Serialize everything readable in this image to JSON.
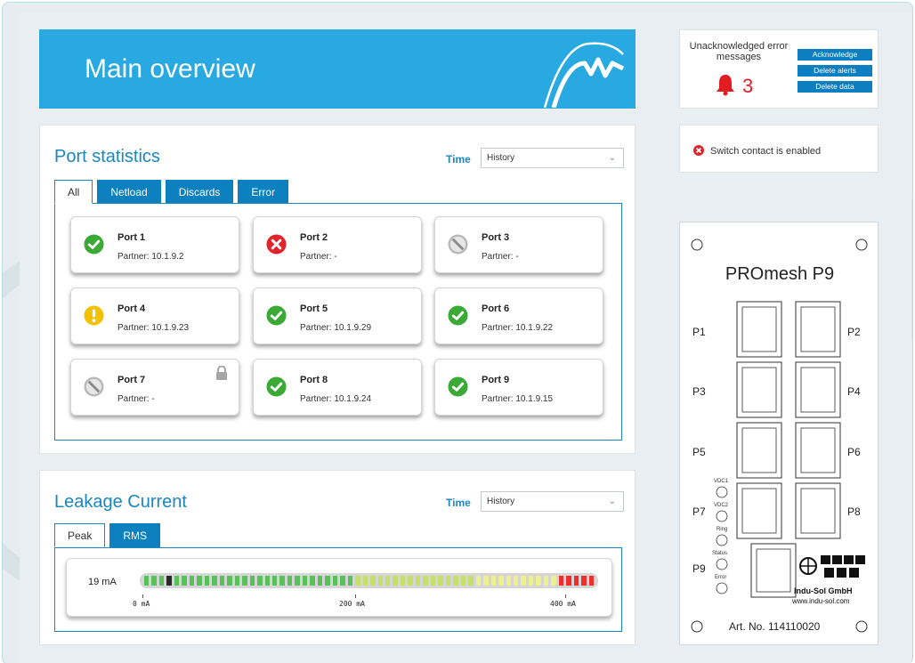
{
  "header": {
    "title": "Main overview"
  },
  "port_statistics": {
    "title": "Port statistics",
    "time_label": "Time",
    "time_value": "History",
    "tabs": [
      "All",
      "Netload",
      "Discards",
      "Error"
    ],
    "ports": [
      {
        "name": "Port 1",
        "partner": "Partner: 10.1.9.2",
        "status": "ok",
        "locked": false
      },
      {
        "name": "Port 2",
        "partner": "Partner: -",
        "status": "error",
        "locked": false
      },
      {
        "name": "Port 3",
        "partner": "Partner: -",
        "status": "disabled",
        "locked": false
      },
      {
        "name": "Port 4",
        "partner": "Partner: 10.1.9.23",
        "status": "warning",
        "locked": false
      },
      {
        "name": "Port 5",
        "partner": "Partner: 10.1.9.29",
        "status": "ok",
        "locked": false
      },
      {
        "name": "Port 6",
        "partner": "Partner: 10.1.9.22",
        "status": "ok",
        "locked": false
      },
      {
        "name": "Port 7",
        "partner": "Partner: -",
        "status": "disabled",
        "locked": true
      },
      {
        "name": "Port 8",
        "partner": "Partner: 10.1.9.24",
        "status": "ok",
        "locked": false
      },
      {
        "name": "Port 9",
        "partner": "Partner: 10.1.9.15",
        "status": "ok",
        "locked": false
      }
    ]
  },
  "leakage": {
    "title": "Leakage Current",
    "time_label": "Time",
    "time_value": "History",
    "tabs": [
      "Peak",
      "RMS"
    ],
    "current_value": "19 mA",
    "current_ma": 19,
    "scale_max_ma": 450,
    "ticks": [
      "0 mA",
      "200 mA",
      "400 mA"
    ]
  },
  "alerts": {
    "title": "Unacknowledged error messages",
    "count": "3",
    "buttons": [
      "Acknowledge",
      "Delete alerts",
      "Delete data"
    ]
  },
  "switch_contact": {
    "text": "Switch contact is enabled"
  },
  "device": {
    "name": "PROmesh P9",
    "ports_left": [
      "P1",
      "P3",
      "P5",
      "P7",
      "P9"
    ],
    "ports_right": [
      "P2",
      "P4",
      "P6",
      "P8"
    ],
    "leds": [
      "VDC1",
      "VDC2",
      "Ring",
      "Status",
      "Error"
    ],
    "company": "Indu-Sol GmbH",
    "website": "www.indu-sol.com",
    "article_no": "Art. No. 114110020"
  },
  "colors": {
    "header_blue": "#29a9e1",
    "tab_blue": "#0d80bf",
    "ok": "#3aa935",
    "error": "#e0242b",
    "warning": "#f2c200",
    "disabled": "#b8b8b8"
  }
}
